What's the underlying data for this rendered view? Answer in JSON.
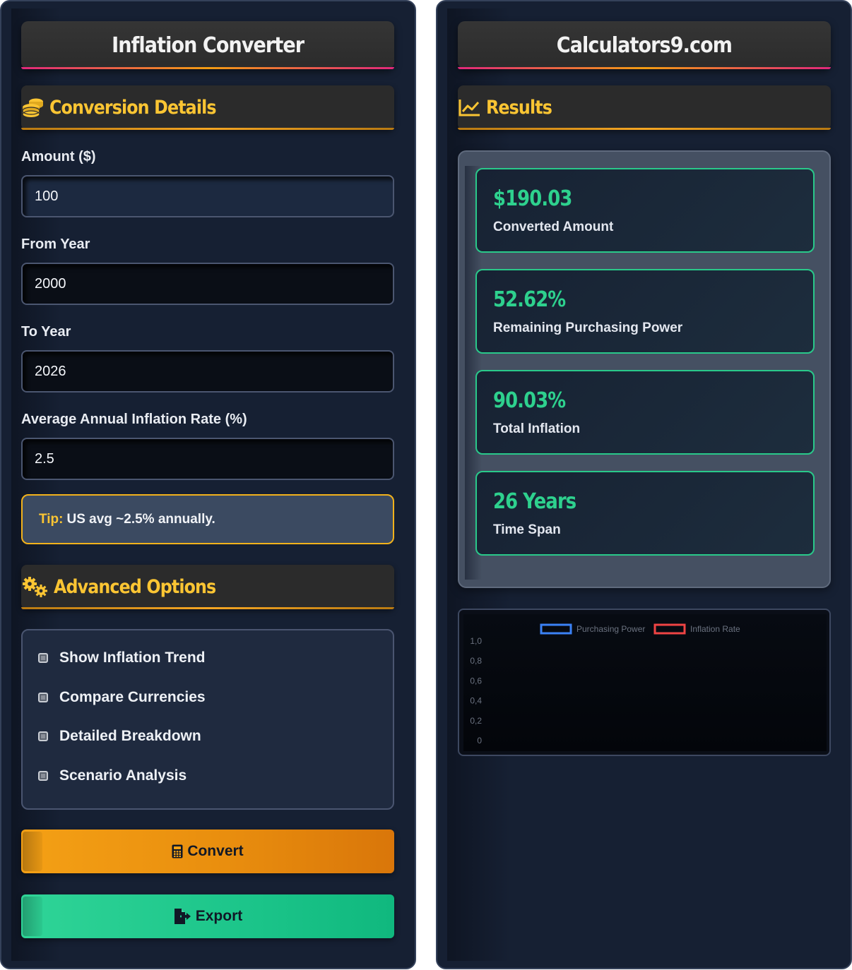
{
  "left_panel": {
    "title": "Inflation Converter",
    "section_conversion": "Conversion Details",
    "fields": [
      {
        "label": "Amount ($)",
        "value": "100"
      },
      {
        "label": "From Year",
        "value": "2000"
      },
      {
        "label": "To Year",
        "value": "2026"
      },
      {
        "label": "Average Annual Inflation Rate (%)",
        "value": "2.5"
      }
    ],
    "tip": {
      "key": "Tip:",
      "text": "US avg ~2.5% annually."
    },
    "section_advanced": "Advanced Options",
    "options": [
      "Show Inflation Trend",
      "Compare Currencies",
      "Detailed Breakdown",
      "Scenario Analysis"
    ],
    "convert_label": "Convert",
    "export_label": "Export"
  },
  "right_panel": {
    "title": "Calculators9.com",
    "section_results": "Results",
    "results": [
      {
        "value": "$190.03",
        "label": "Converted Amount"
      },
      {
        "value": "52.62%",
        "label": "Remaining Purchasing Power"
      },
      {
        "value": "90.03%",
        "label": "Total Inflation"
      },
      {
        "value": "26 Years",
        "label": "Time Span"
      }
    ]
  },
  "colors": {
    "accent_yellow": "#fbc533",
    "result_green": "#2ed18e",
    "convert_orange": "#f4a015",
    "export_green": "#1cc58a"
  },
  "chart_data": {
    "type": "line",
    "series": [
      {
        "name": "Purchasing Power",
        "color": "#3b82f6",
        "values": []
      },
      {
        "name": "Inflation Rate",
        "color": "#ef4444",
        "values": []
      }
    ],
    "y_ticks": [
      "1,0",
      "0,8",
      "0,6",
      "0,4",
      "0,2",
      "0"
    ],
    "ylim": [
      0,
      1
    ],
    "legend": "top-center",
    "grid": false
  }
}
